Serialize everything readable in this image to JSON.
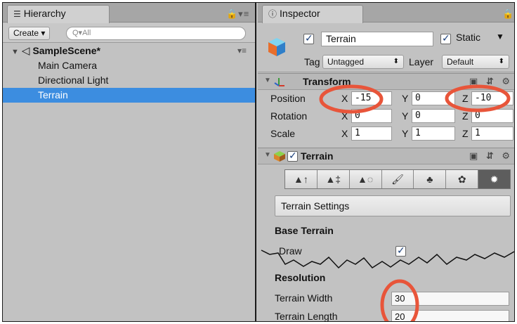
{
  "hierarchy": {
    "tab_label": "Hierarchy",
    "tab_icon": "list-icon",
    "create_label": "Create",
    "search_placeholder": "Q▾All",
    "scene_name": "SampleScene*",
    "items": [
      {
        "label": "Main Camera",
        "selected": false
      },
      {
        "label": "Directional Light",
        "selected": false
      },
      {
        "label": "Terrain",
        "selected": true
      }
    ]
  },
  "inspector": {
    "tab_label": "Inspector",
    "tab_icon": "info-icon",
    "object_name": "Terrain",
    "active": true,
    "static_label": "Static",
    "static_checked": true,
    "tag_label": "Tag",
    "tag_value": "Untagged",
    "layer_label": "Layer",
    "layer_value": "Default"
  },
  "transform": {
    "title": "Transform",
    "rows": [
      {
        "label": "Position",
        "x": "-15",
        "y": "0",
        "z": "-10"
      },
      {
        "label": "Rotation",
        "x": "0",
        "y": "0",
        "z": "0"
      },
      {
        "label": "Scale",
        "x": "1",
        "y": "1",
        "z": "1"
      }
    ],
    "axis_labels": {
      "x": "X",
      "y": "Y",
      "z": "Z"
    }
  },
  "terrain": {
    "title": "Terrain",
    "enabled": true,
    "tools": [
      "raise-lower-icon",
      "paint-height-icon",
      "smooth-height-icon",
      "paint-texture-icon",
      "place-trees-icon",
      "paint-details-icon",
      "settings-gear-icon"
    ],
    "settings_label": "Terrain Settings",
    "base_terrain_label": "Base Terrain",
    "draw_label": "Draw",
    "draw_checked": true,
    "resolution_label": "Resolution",
    "width_label": "Terrain Width",
    "width_value": "30",
    "length_label": "Terrain Length",
    "length_value": "20"
  },
  "colors": {
    "selection": "#3c8de0",
    "annotation": "#e8553a",
    "panel_bg": "#c2c2c2"
  }
}
